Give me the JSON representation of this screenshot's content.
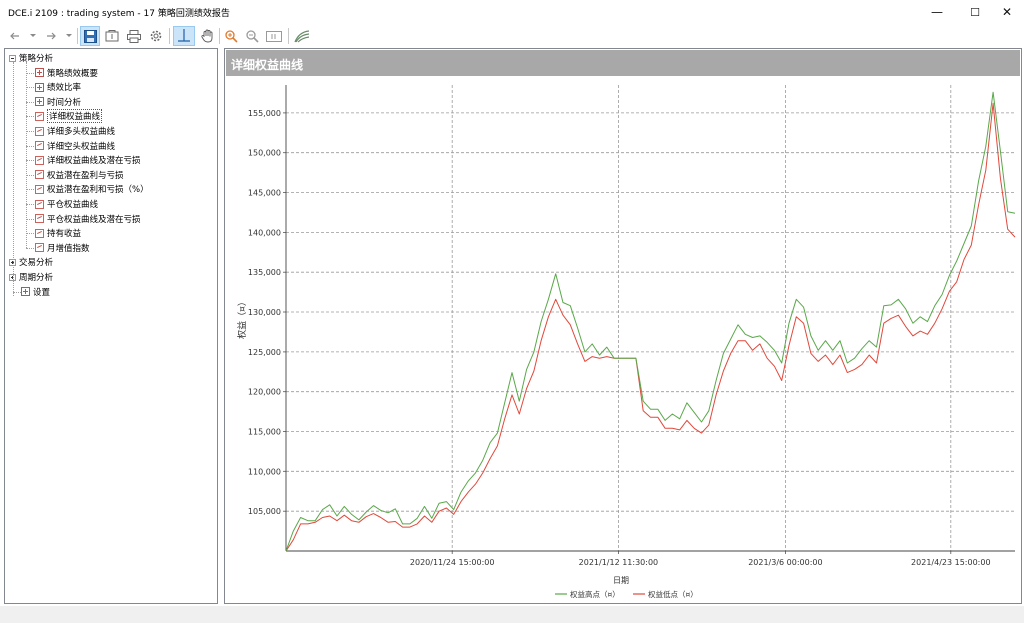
{
  "window": {
    "title": "DCE.i 2109 : trading system - 17 策略回测绩效报告",
    "minimize": "—",
    "maximize": "☐",
    "close": "✕"
  },
  "toolbar": {
    "icons": [
      "back-arrow-icon",
      "back-dropdown-icon",
      "forward-arrow-icon",
      "forward-dropdown-icon",
      "save-icon",
      "open-report-icon",
      "print-icon",
      "settings-icon",
      "crosshair-icon",
      "pan-hand-icon",
      "zoom-in-icon",
      "zoom-out-icon",
      "zoom-fit-icon",
      "chart-style-icon"
    ]
  },
  "tree": {
    "groups": [
      {
        "label": "策略分析",
        "expanded": true,
        "items": [
          {
            "label": "策略绩效概要",
            "icon": "grid"
          },
          {
            "label": "绩效比率",
            "icon": "grid"
          },
          {
            "label": "时间分析",
            "icon": "grid"
          },
          {
            "label": "详细权益曲线",
            "icon": "chart",
            "selected": true
          },
          {
            "label": "详细多头权益曲线",
            "icon": "chart"
          },
          {
            "label": "详细空头权益曲线",
            "icon": "chart"
          },
          {
            "label": "详细权益曲线及潜在亏损",
            "icon": "chart"
          },
          {
            "label": "权益潜在盈利与亏损",
            "icon": "chart"
          },
          {
            "label": "权益潜在盈利和亏损（%）",
            "icon": "chart"
          },
          {
            "label": "平仓权益曲线",
            "icon": "chart"
          },
          {
            "label": "平仓权益曲线及潜在亏损",
            "icon": "chart"
          },
          {
            "label": "持有收益",
            "icon": "chart"
          },
          {
            "label": "月增值指数",
            "icon": "chart"
          }
        ]
      },
      {
        "label": "交易分析",
        "expanded": false,
        "items": []
      },
      {
        "label": "周期分析",
        "expanded": false,
        "items": []
      }
    ],
    "root_items": [
      {
        "label": "设置",
        "icon": "grid"
      }
    ]
  },
  "chart_header": {
    "title": "详细权益曲线"
  },
  "chart_data": {
    "type": "line",
    "title": "详细权益曲线",
    "xlabel": "日期",
    "ylabel": "权益（¤）",
    "ylim": [
      100000,
      158500
    ],
    "yticks": [
      105000,
      110000,
      115000,
      120000,
      125000,
      130000,
      135000,
      140000,
      145000,
      150000,
      155000
    ],
    "ytick_labels": [
      "105,000",
      "110,000",
      "115,000",
      "120,000",
      "125,000",
      "130,000",
      "135,000",
      "140,000",
      "145,000",
      "150,000",
      "155,000"
    ],
    "x_index_max": 100,
    "xticks": [
      {
        "index": 22.8,
        "label": "2020/11/24 15:00:00"
      },
      {
        "index": 45.6,
        "label": "2021/1/12 11:30:00"
      },
      {
        "index": 68.5,
        "label": "2021/3/6 00:00:00"
      },
      {
        "index": 91.2,
        "label": "2021/4/23 15:00:00"
      }
    ],
    "grid": true,
    "legend_position": "bottom-center",
    "series": [
      {
        "name": "权益高点（¤）",
        "color": "#5aa84a",
        "points": [
          [
            0,
            100000
          ],
          [
            1,
            102500
          ],
          [
            2,
            104200
          ],
          [
            3,
            103800
          ],
          [
            4,
            103800
          ],
          [
            5,
            105200
          ],
          [
            6,
            105800
          ],
          [
            7,
            104400
          ],
          [
            8,
            105600
          ],
          [
            9,
            104600
          ],
          [
            10,
            103900
          ],
          [
            11,
            104900
          ],
          [
            12,
            105700
          ],
          [
            13,
            105100
          ],
          [
            14,
            104800
          ],
          [
            15,
            105300
          ],
          [
            16,
            103400
          ],
          [
            17,
            103400
          ],
          [
            18,
            104100
          ],
          [
            19,
            105600
          ],
          [
            20,
            104100
          ],
          [
            21,
            106000
          ],
          [
            22,
            106200
          ],
          [
            23,
            105200
          ],
          [
            24,
            107400
          ],
          [
            25,
            108800
          ],
          [
            26,
            109800
          ],
          [
            27,
            111400
          ],
          [
            28,
            113600
          ],
          [
            29,
            114800
          ],
          [
            30,
            118600
          ],
          [
            31,
            122400
          ],
          [
            32,
            118800
          ],
          [
            33,
            122800
          ],
          [
            34,
            125000
          ],
          [
            35,
            128800
          ],
          [
            36,
            131600
          ],
          [
            37,
            134800
          ],
          [
            38,
            131200
          ],
          [
            39,
            130800
          ],
          [
            40,
            128000
          ],
          [
            41,
            125000
          ],
          [
            42,
            126000
          ],
          [
            43,
            124600
          ],
          [
            44,
            125600
          ],
          [
            45,
            124200
          ],
          [
            46,
            124200
          ],
          [
            47,
            124200
          ],
          [
            48,
            124200
          ],
          [
            49,
            118800
          ],
          [
            50,
            117800
          ],
          [
            51,
            117800
          ],
          [
            52,
            116400
          ],
          [
            53,
            117200
          ],
          [
            54,
            116600
          ],
          [
            55,
            118600
          ],
          [
            56,
            117400
          ],
          [
            57,
            116200
          ],
          [
            58,
            117600
          ],
          [
            59,
            121400
          ],
          [
            60,
            124800
          ],
          [
            61,
            126600
          ],
          [
            62,
            128400
          ],
          [
            63,
            127200
          ],
          [
            64,
            126800
          ],
          [
            65,
            127000
          ],
          [
            66,
            126200
          ],
          [
            67,
            125200
          ],
          [
            68,
            123600
          ],
          [
            69,
            128600
          ],
          [
            70,
            131600
          ],
          [
            71,
            130600
          ],
          [
            72,
            127000
          ],
          [
            73,
            125200
          ],
          [
            74,
            126400
          ],
          [
            75,
            125200
          ],
          [
            76,
            126400
          ],
          [
            77,
            123600
          ],
          [
            78,
            124200
          ],
          [
            79,
            125400
          ],
          [
            80,
            126400
          ],
          [
            81,
            125600
          ],
          [
            82,
            130800
          ],
          [
            83,
            130900
          ],
          [
            84,
            131600
          ],
          [
            85,
            130400
          ],
          [
            86,
            128600
          ],
          [
            87,
            129400
          ],
          [
            88,
            128800
          ],
          [
            89,
            130800
          ],
          [
            90,
            132200
          ],
          [
            91,
            134600
          ],
          [
            92,
            136400
          ],
          [
            93,
            138600
          ],
          [
            94,
            140800
          ],
          [
            95,
            146400
          ],
          [
            96,
            150800
          ],
          [
            97,
            157600
          ],
          [
            98,
            150200
          ],
          [
            99,
            142600
          ],
          [
            100,
            142400
          ]
        ]
      },
      {
        "name": "权益低点（¤）",
        "color": "#e0493c",
        "points": [
          [
            0,
            100000
          ],
          [
            1,
            101400
          ],
          [
            2,
            103400
          ],
          [
            3,
            103400
          ],
          [
            4,
            103600
          ],
          [
            5,
            104200
          ],
          [
            6,
            104400
          ],
          [
            7,
            103800
          ],
          [
            8,
            104500
          ],
          [
            9,
            103800
          ],
          [
            10,
            103600
          ],
          [
            11,
            104300
          ],
          [
            12,
            104700
          ],
          [
            13,
            104200
          ],
          [
            14,
            103600
          ],
          [
            15,
            103700
          ],
          [
            16,
            103000
          ],
          [
            17,
            103000
          ],
          [
            18,
            103400
          ],
          [
            19,
            104400
          ],
          [
            20,
            103600
          ],
          [
            21,
            105000
          ],
          [
            22,
            105400
          ],
          [
            23,
            104600
          ],
          [
            24,
            106200
          ],
          [
            25,
            107400
          ],
          [
            26,
            108400
          ],
          [
            27,
            109800
          ],
          [
            28,
            111600
          ],
          [
            29,
            113200
          ],
          [
            30,
            116600
          ],
          [
            31,
            119600
          ],
          [
            32,
            117200
          ],
          [
            33,
            120400
          ],
          [
            34,
            122600
          ],
          [
            35,
            126400
          ],
          [
            36,
            129400
          ],
          [
            37,
            131600
          ],
          [
            38,
            129600
          ],
          [
            39,
            128400
          ],
          [
            40,
            126000
          ],
          [
            41,
            123800
          ],
          [
            42,
            124400
          ],
          [
            43,
            124200
          ],
          [
            44,
            124400
          ],
          [
            45,
            124200
          ],
          [
            46,
            124200
          ],
          [
            47,
            124200
          ],
          [
            48,
            124200
          ],
          [
            49,
            117600
          ],
          [
            50,
            116800
          ],
          [
            51,
            116800
          ],
          [
            52,
            115400
          ],
          [
            53,
            115400
          ],
          [
            54,
            115200
          ],
          [
            55,
            116400
          ],
          [
            56,
            115400
          ],
          [
            57,
            114800
          ],
          [
            58,
            115800
          ],
          [
            59,
            119600
          ],
          [
            60,
            122600
          ],
          [
            61,
            124800
          ],
          [
            62,
            126400
          ],
          [
            63,
            126400
          ],
          [
            64,
            125200
          ],
          [
            65,
            126000
          ],
          [
            66,
            124200
          ],
          [
            67,
            123200
          ],
          [
            68,
            121400
          ],
          [
            69,
            125800
          ],
          [
            70,
            129400
          ],
          [
            71,
            128600
          ],
          [
            72,
            124800
          ],
          [
            73,
            123800
          ],
          [
            74,
            124600
          ],
          [
            75,
            123400
          ],
          [
            76,
            124600
          ],
          [
            77,
            122400
          ],
          [
            78,
            122800
          ],
          [
            79,
            123400
          ],
          [
            80,
            124600
          ],
          [
            81,
            123600
          ],
          [
            82,
            128600
          ],
          [
            83,
            129200
          ],
          [
            84,
            129600
          ],
          [
            85,
            128200
          ],
          [
            86,
            127000
          ],
          [
            87,
            127600
          ],
          [
            88,
            127200
          ],
          [
            89,
            128600
          ],
          [
            90,
            130400
          ],
          [
            91,
            132600
          ],
          [
            92,
            133800
          ],
          [
            93,
            136600
          ],
          [
            94,
            138400
          ],
          [
            95,
            143400
          ],
          [
            96,
            147800
          ],
          [
            97,
            156200
          ],
          [
            98,
            146800
          ],
          [
            99,
            140400
          ],
          [
            100,
            139400
          ]
        ]
      }
    ]
  }
}
